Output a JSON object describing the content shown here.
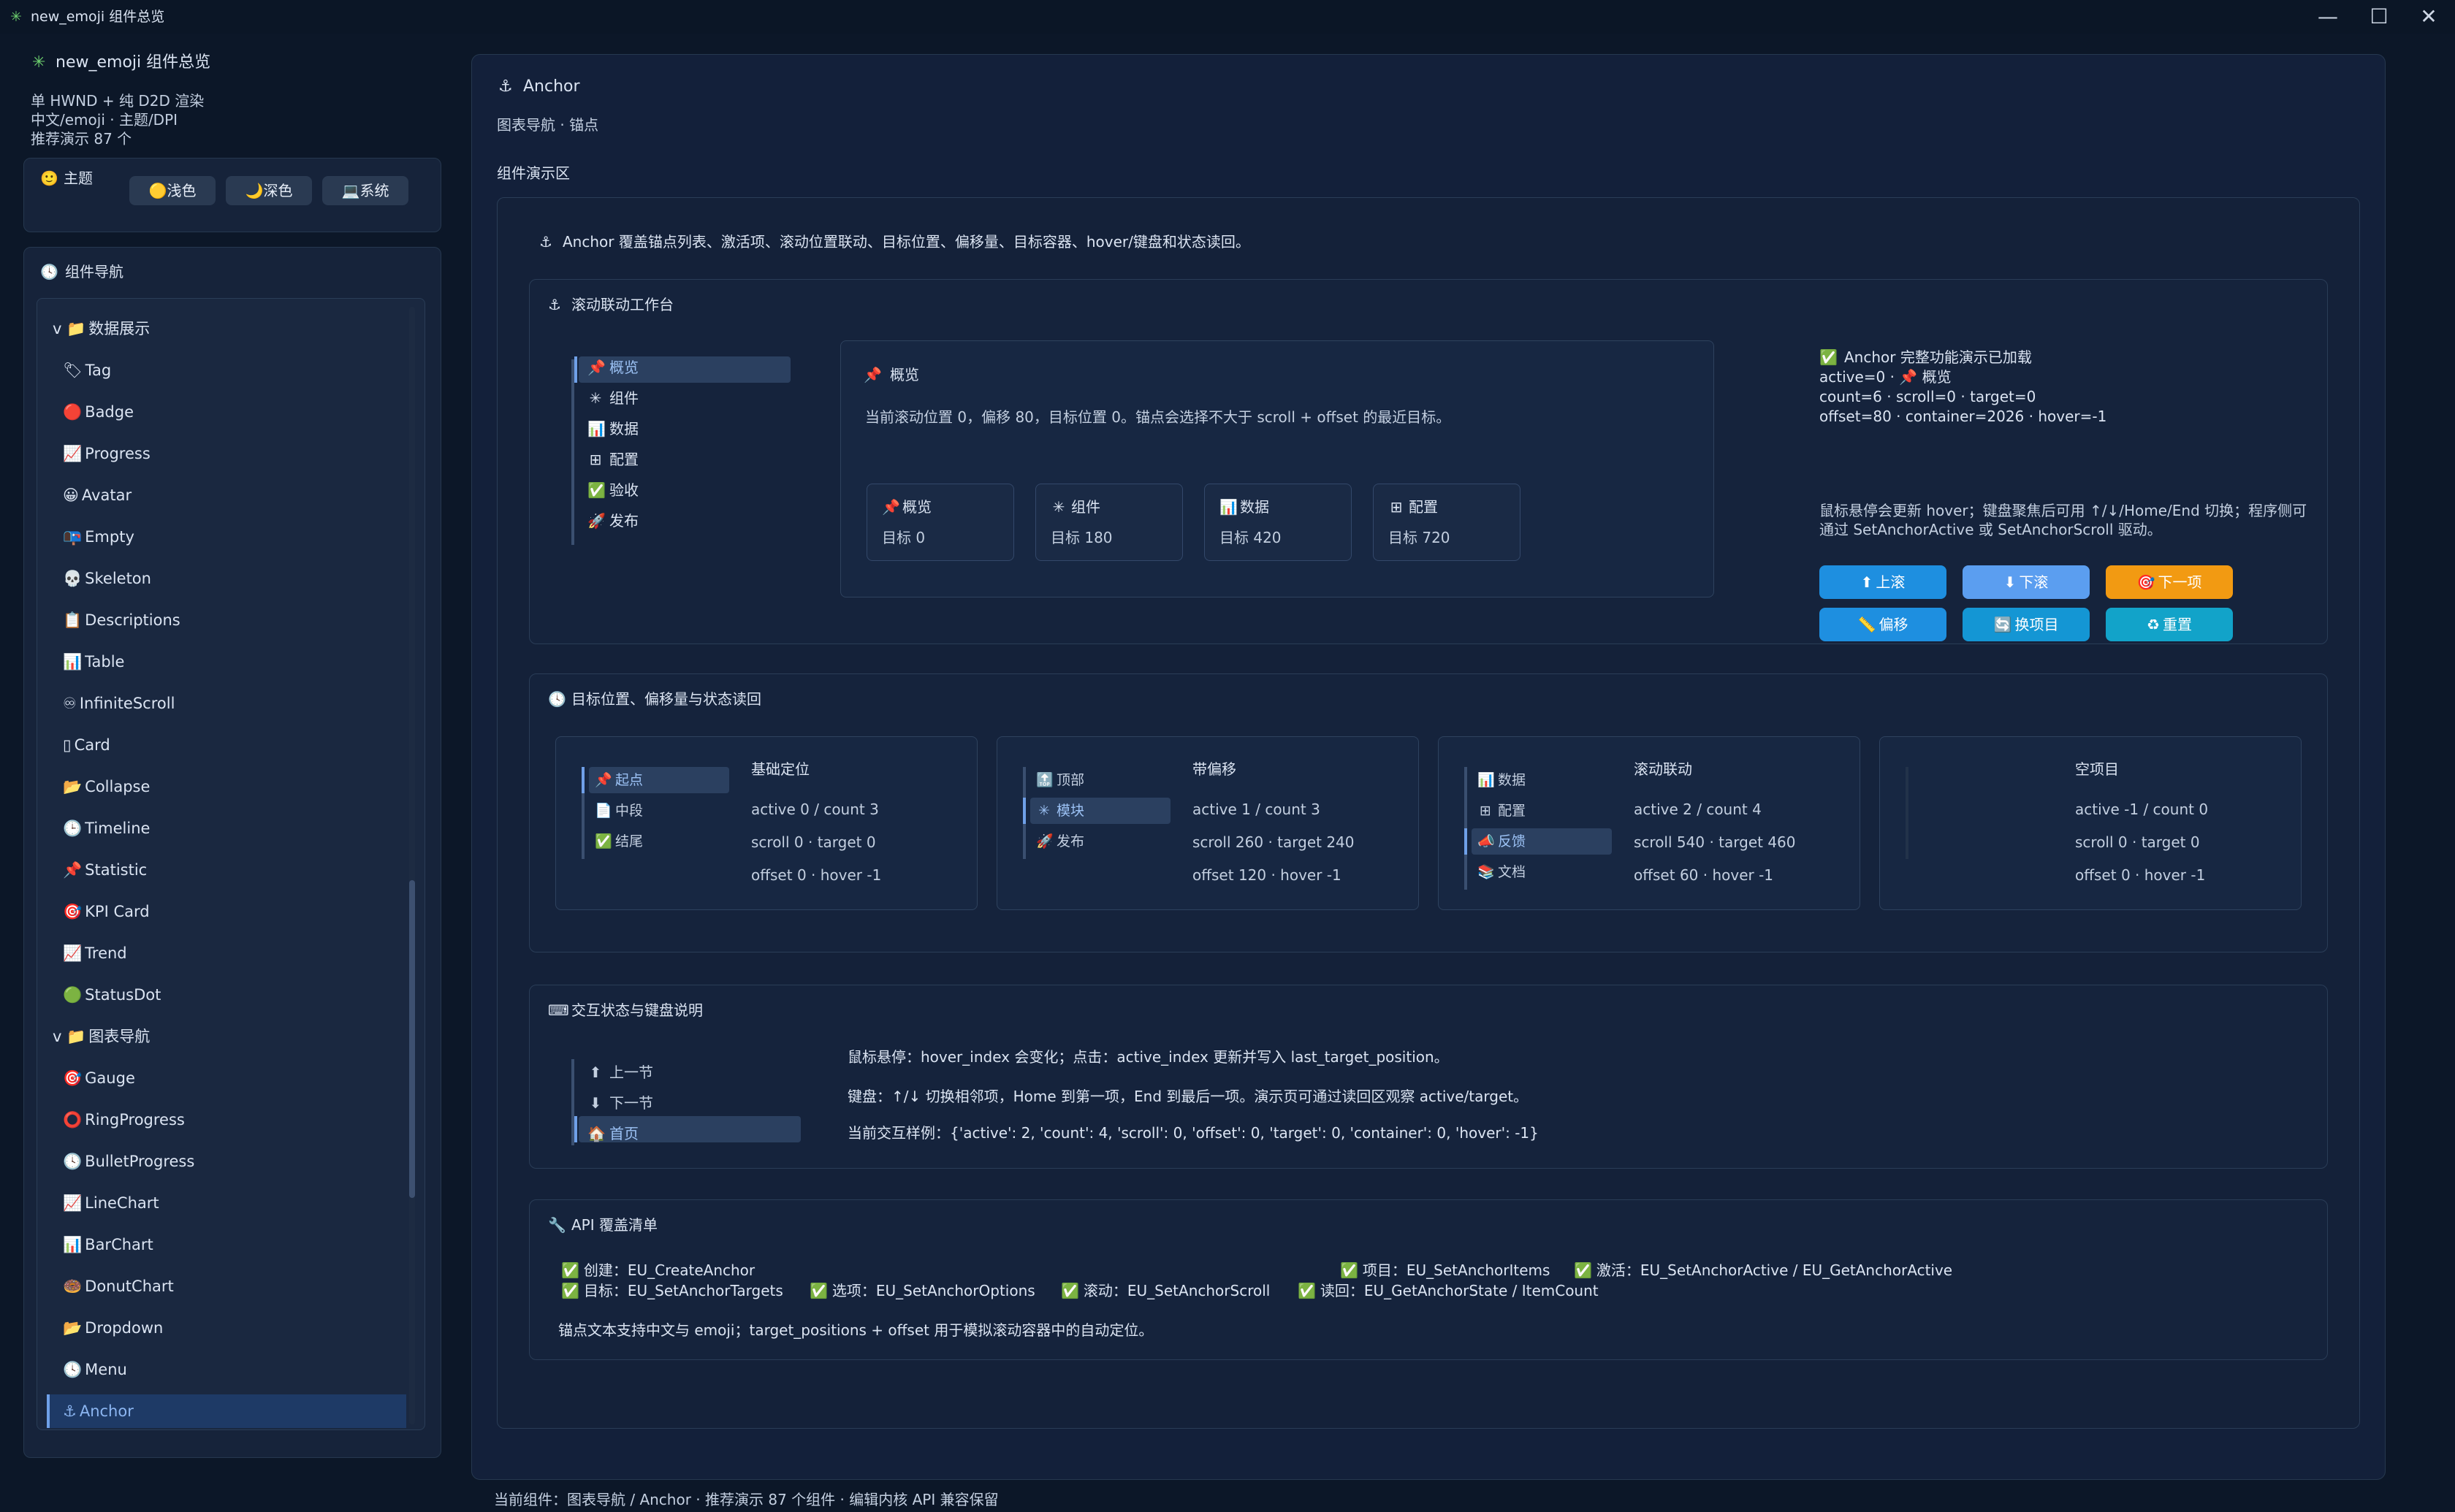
{
  "window": {
    "title": "new_emoji 组件总览",
    "icon": "✳",
    "controls": [
      "—",
      "☐",
      "✕"
    ]
  },
  "sidebar": {
    "app_title": "new_emoji 组件总览",
    "info": [
      "单 HWND + 纯 D2D 渲染",
      "中文/emoji · 主题/DPI",
      "推荐演示 87 个"
    ],
    "theme": {
      "label": "主题",
      "icon": "🙂",
      "buttons": [
        {
          "icon": "🟡",
          "label": "浅色"
        },
        {
          "icon": "🌙",
          "label": "深色"
        },
        {
          "icon": "💻",
          "label": "系统"
        }
      ]
    },
    "nav": {
      "title": "组件导航",
      "icon": "🕓",
      "items": [
        {
          "icon": "v 📁",
          "label": "数据展示"
        },
        {
          "icon": "🏷",
          "label": "Tag"
        },
        {
          "icon": "🔴",
          "label": "Badge"
        },
        {
          "icon": "📈",
          "label": "Progress"
        },
        {
          "icon": "😀",
          "label": "Avatar"
        },
        {
          "icon": "📭",
          "label": "Empty"
        },
        {
          "icon": "💀",
          "label": "Skeleton"
        },
        {
          "icon": "📋",
          "label": "Descriptions"
        },
        {
          "icon": "📊",
          "label": "Table"
        },
        {
          "icon": "♾",
          "label": "InfiniteScroll"
        },
        {
          "icon": "▯",
          "label": "Card"
        },
        {
          "icon": "📂",
          "label": "Collapse"
        },
        {
          "icon": "🕒",
          "label": "Timeline"
        },
        {
          "icon": "📌",
          "label": "Statistic"
        },
        {
          "icon": "🎯",
          "label": "KPI Card"
        },
        {
          "icon": "📈",
          "label": "Trend"
        },
        {
          "icon": "🟢",
          "label": "StatusDot"
        },
        {
          "icon": "v 📁",
          "label": "图表导航"
        },
        {
          "icon": "🎯",
          "label": "Gauge"
        },
        {
          "icon": "⭕",
          "label": "RingProgress"
        },
        {
          "icon": "🕓",
          "label": "BulletProgress"
        },
        {
          "icon": "📈",
          "label": "LineChart"
        },
        {
          "icon": "📊",
          "label": "BarChart"
        },
        {
          "icon": "🍩",
          "label": "DonutChart"
        },
        {
          "icon": "📂",
          "label": "Dropdown"
        },
        {
          "icon": "🕓",
          "label": "Menu"
        },
        {
          "icon": "⚓",
          "label": "Anchor"
        }
      ],
      "active_index": 26
    }
  },
  "main": {
    "title": "Anchor",
    "title_icon": "⚓",
    "breadcrumb": "图表导航 · 锚点",
    "demo_label": "组件演示区",
    "intro": "Anchor 覆盖锚点列表、激活项、滚动位置联动、目标位置、偏移量、目标容器、hover/键盘和状态读回。",
    "workbench": {
      "title": "滚动联动工作台",
      "anchors": [
        {
          "icon": "📌",
          "label": "概览"
        },
        {
          "icon": "✳",
          "label": "组件"
        },
        {
          "icon": "📊",
          "label": "数据"
        },
        {
          "icon": "⊞",
          "label": "配置"
        },
        {
          "icon": "✅",
          "label": "验收"
        },
        {
          "icon": "🚀",
          "label": "发布"
        }
      ],
      "active_anchor": 0,
      "content_title": "概览",
      "content_title_icon": "📌",
      "content_desc": "当前滚动位置 0，偏移 80，目标位置 0。锚点会选择不大于 scroll + offset 的最近目标。",
      "targets": [
        {
          "icon": "📌",
          "label": "概览",
          "value": "目标 0"
        },
        {
          "icon": "✳",
          "label": "组件",
          "value": "目标 180"
        },
        {
          "icon": "📊",
          "label": "数据",
          "value": "目标 420"
        },
        {
          "icon": "⊞",
          "label": "配置",
          "value": "目标 720"
        }
      ],
      "status": {
        "headline": "Anchor 完整功能演示已加载",
        "line1": "active=0 · 📌 概览",
        "line2": "count=6 · scroll=0 · target=0",
        "line3": "offset=80 · container=2026 · hover=-1"
      },
      "hint": "鼠标悬停会更新 hover；键盘聚焦后可用 ↑/↓/Home/End 切换；程序侧可通过 SetAnchorActive 或 SetAnchorScroll 驱动。",
      "buttons": [
        {
          "icon": "⬆",
          "label": "上滚",
          "color": "#1e8fe0"
        },
        {
          "icon": "⬇",
          "label": "下滚",
          "color": "#5b9ef0"
        },
        {
          "icon": "🎯",
          "label": "下一项",
          "color": "#f29a12"
        },
        {
          "icon": "📏",
          "label": "偏移",
          "color": "#1e8fe0"
        },
        {
          "icon": "🔄",
          "label": "换项目",
          "color": "#1496d4"
        },
        {
          "icon": "♻",
          "label": "重置",
          "color": "#12a3c9"
        }
      ]
    },
    "targets_section": {
      "title": "目标位置、偏移量与状态读回",
      "icon": "🕓",
      "cards": [
        {
          "title": "基础定位",
          "items": [
            {
              "icon": "📌",
              "label": "起点"
            },
            {
              "icon": "📄",
              "label": "中段"
            },
            {
              "icon": "✅",
              "label": "结尾"
            }
          ],
          "active": 0,
          "lines": [
            "active 0 / count 3",
            "scroll 0 · target 0",
            "offset 0 · hover -1"
          ]
        },
        {
          "title": "带偏移",
          "items": [
            {
              "icon": "🔝",
              "label": "顶部"
            },
            {
              "icon": "✳",
              "label": "模块"
            },
            {
              "icon": "🚀",
              "label": "发布"
            }
          ],
          "active": 1,
          "lines": [
            "active 1 / count 3",
            "scroll 260 · target 240",
            "offset 120 · hover -1"
          ]
        },
        {
          "title": "滚动联动",
          "items": [
            {
              "icon": "📊",
              "label": "数据"
            },
            {
              "icon": "⊞",
              "label": "配置"
            },
            {
              "icon": "📣",
              "label": "反馈"
            },
            {
              "icon": "📚",
              "label": "文档"
            }
          ],
          "active": 2,
          "lines": [
            "active 2 / count 4",
            "scroll 540 · target 460",
            "offset 60 · hover -1"
          ]
        },
        {
          "title": "空项目",
          "items": [],
          "active": -1,
          "lines": [
            "active -1 / count 0",
            "scroll 0 · target 0",
            "offset 0 · hover -1"
          ]
        }
      ]
    },
    "interaction": {
      "title": "交互状态与键盘说明",
      "icon": "⌨",
      "items": [
        {
          "icon": "⬆",
          "label": "上一节"
        },
        {
          "icon": "⬇",
          "label": "下一节"
        },
        {
          "icon": "🏠",
          "label": "首页"
        }
      ],
      "active": 2,
      "line1": "鼠标悬停：hover_index 会变化；点击：active_index 更新并写入 last_target_position。",
      "line2": "键盘：↑/↓ 切换相邻项，Home 到第一项，End 到最后一项。演示页可通过读回区观察 active/target。",
      "line3": "当前交互样例：{'active': 2, 'count': 4, 'scroll': 0, 'offset': 0, 'target': 0, 'container': 0, 'hover': -1}"
    },
    "api": {
      "title": "API 覆盖清单",
      "icon": "🔧",
      "row1": [
        "创建：EU_CreateAnchor",
        "项目：EU_SetAnchorItems",
        "激活：EU_SetAnchorActive / EU_GetAnchorActive"
      ],
      "row2": [
        "目标：EU_SetAnchorTargets",
        "选项：EU_SetAnchorOptions",
        "滚动：EU_SetAnchorScroll",
        "读回：EU_GetAnchorState / ItemCount"
      ],
      "footer": "锚点文本支持中文与 emoji；target_positions + offset 用于模拟滚动容器中的自动定位。"
    }
  },
  "statusbar": "当前组件：图表导航 / Anchor · 推荐演示 87 个组件 · 编辑内核 API 兼容保留",
  "colors": {
    "background": "#0c1728",
    "card": "#16233a",
    "accent": "#6fa0e8",
    "check": "#22b04b"
  }
}
